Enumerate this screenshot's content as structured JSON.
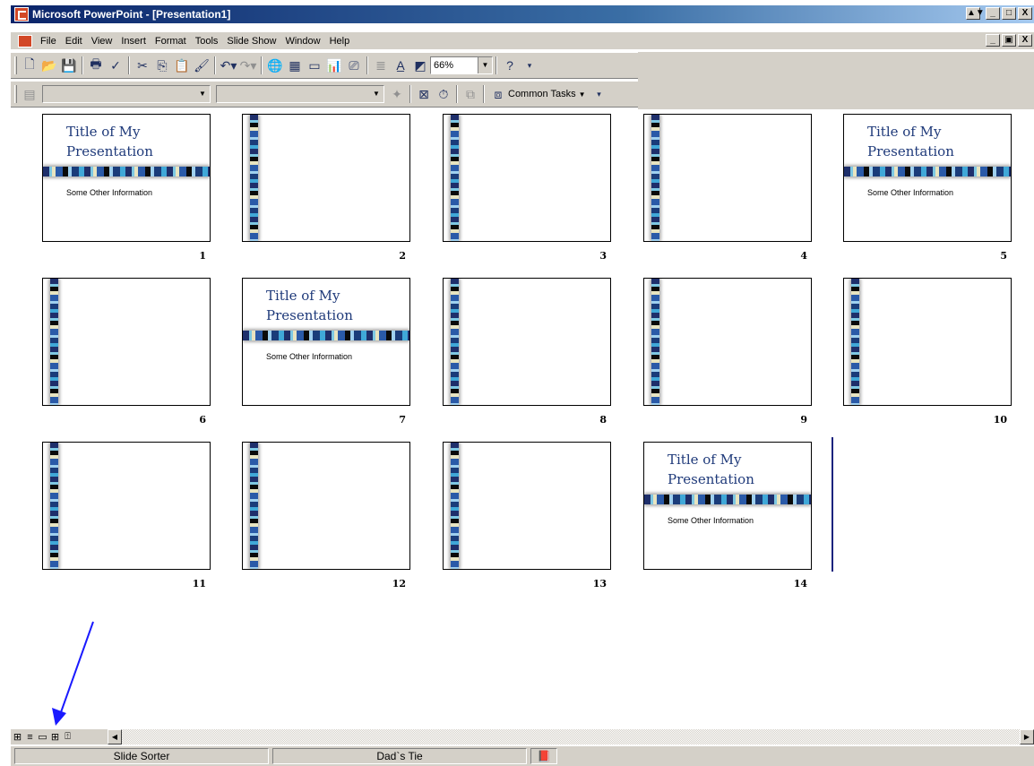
{
  "window": {
    "title": "Microsoft PowerPoint - [Presentation1]",
    "buttons": [
      "▲▼",
      "_",
      "□",
      "X"
    ],
    "doc_buttons": [
      "_",
      "▣",
      "X"
    ]
  },
  "menu": [
    "File",
    "Edit",
    "View",
    "Insert",
    "Format",
    "Tools",
    "Slide Show",
    "Window",
    "Help"
  ],
  "toolbar1": {
    "icons": [
      "new-icon",
      "open-icon",
      "save-icon",
      "print-icon",
      "spelling-icon",
      "cut-icon",
      "copy-icon",
      "paste-icon",
      "format-painter-icon",
      "undo-icon",
      "redo-icon",
      "hyperlink-icon",
      "tables-borders-icon",
      "insert-table-icon",
      "insert-chart-icon",
      "new-slide-icon",
      "expand-icon",
      "show-formatting-icon",
      "grayscale-icon",
      "help-icon"
    ],
    "zoom": "66%"
  },
  "toolbar2": {
    "common_tasks_label": "Common Tasks"
  },
  "slides": [
    {
      "number": "1",
      "type": "title",
      "title_line1": "Title of My",
      "title_line2": "Presentation",
      "subtitle": "Some Other Information"
    },
    {
      "number": "2",
      "type": "blank"
    },
    {
      "number": "3",
      "type": "blank"
    },
    {
      "number": "4",
      "type": "blank"
    },
    {
      "number": "5",
      "type": "title",
      "title_line1": "Title of My",
      "title_line2": "Presentation",
      "subtitle": "Some Other Information"
    },
    {
      "number": "6",
      "type": "blank"
    },
    {
      "number": "7",
      "type": "title",
      "title_line1": "Title of My",
      "title_line2": "Presentation",
      "subtitle": "Some Other Information"
    },
    {
      "number": "8",
      "type": "blank"
    },
    {
      "number": "9",
      "type": "blank"
    },
    {
      "number": "10",
      "type": "blank"
    },
    {
      "number": "11",
      "type": "blank"
    },
    {
      "number": "12",
      "type": "blank"
    },
    {
      "number": "13",
      "type": "blank"
    },
    {
      "number": "14",
      "type": "title",
      "title_line1": "Title of My",
      "title_line2": "Presentation",
      "subtitle": "Some Other Information"
    }
  ],
  "view_buttons": [
    "normal-view-icon",
    "outline-view-icon",
    "slide-view-icon",
    "slide-sorter-view-icon",
    "slide-show-icon"
  ],
  "status": {
    "view": "Slide Sorter",
    "design": "Dad`s Tie"
  },
  "colors": {
    "title_bar": "#0a246a",
    "chrome": "#d4d0c8",
    "slide_title_text": "#1f3a7a",
    "annotation_arrow": "#1a1aff"
  }
}
